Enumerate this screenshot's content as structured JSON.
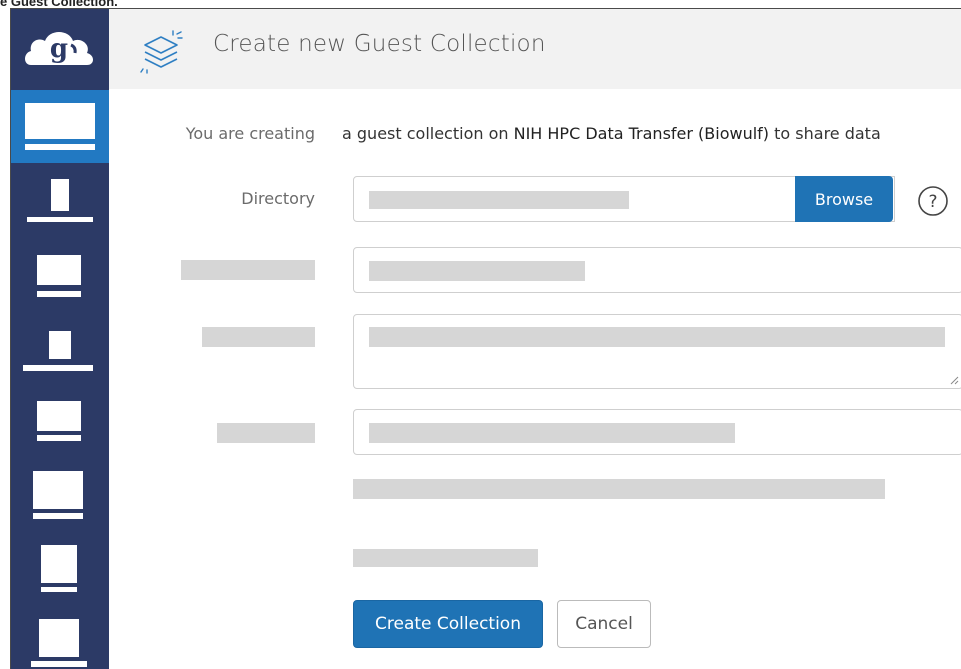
{
  "caption": "e Guest Collection.",
  "header": {
    "title": "Create new Guest Collection",
    "icon": "layers-sparkle-icon"
  },
  "sidebar": {
    "logo": "globus-cloud-logo",
    "items": [
      "nav-item-1",
      "nav-item-2",
      "nav-item-3",
      "nav-item-4",
      "nav-item-5",
      "nav-item-6",
      "nav-item-7",
      "nav-item-8"
    ],
    "active_index": 0,
    "colors": {
      "background": "#2c3a66",
      "active": "#2279c2"
    }
  },
  "form": {
    "creating_label": "You are creating",
    "creating_prefix": "a guest collection on ",
    "endpoint_name": "NIH HPC Data Transfer (Biowulf)",
    "creating_suffix": " to share data",
    "directory_label": "Directory",
    "browse_label": "Browse",
    "help_icon": "question-circle-icon"
  },
  "actions": {
    "create_label": "Create Collection",
    "cancel_label": "Cancel"
  },
  "colors": {
    "primary": "#1f73b5",
    "redaction": "#d6d6d6"
  }
}
